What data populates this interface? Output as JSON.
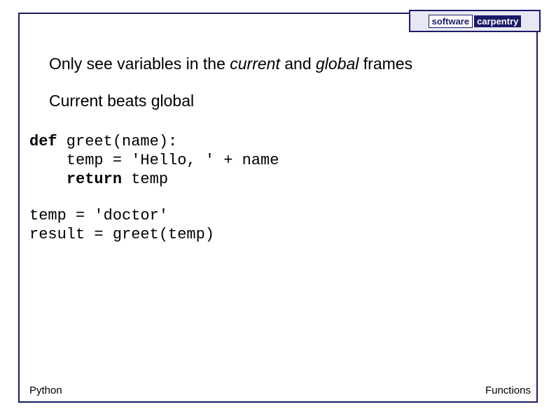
{
  "logo": {
    "word1": "software",
    "word2": "carpentry"
  },
  "heading": {
    "prefix": "Only see variables in the ",
    "italic1": "current",
    "mid": " and ",
    "italic2": "global",
    "suffix": " frames"
  },
  "subheading": "Current beats global",
  "code": {
    "l1_kw": "def",
    "l1_rest": " greet(name):",
    "l2": "    temp = 'Hello, ' + name",
    "l3_pad": "    ",
    "l3_kw": "return",
    "l3_rest": " temp",
    "l4": "temp = 'doctor'",
    "l5": "result = greet(temp)"
  },
  "footer": {
    "left": "Python",
    "right": "Functions"
  }
}
